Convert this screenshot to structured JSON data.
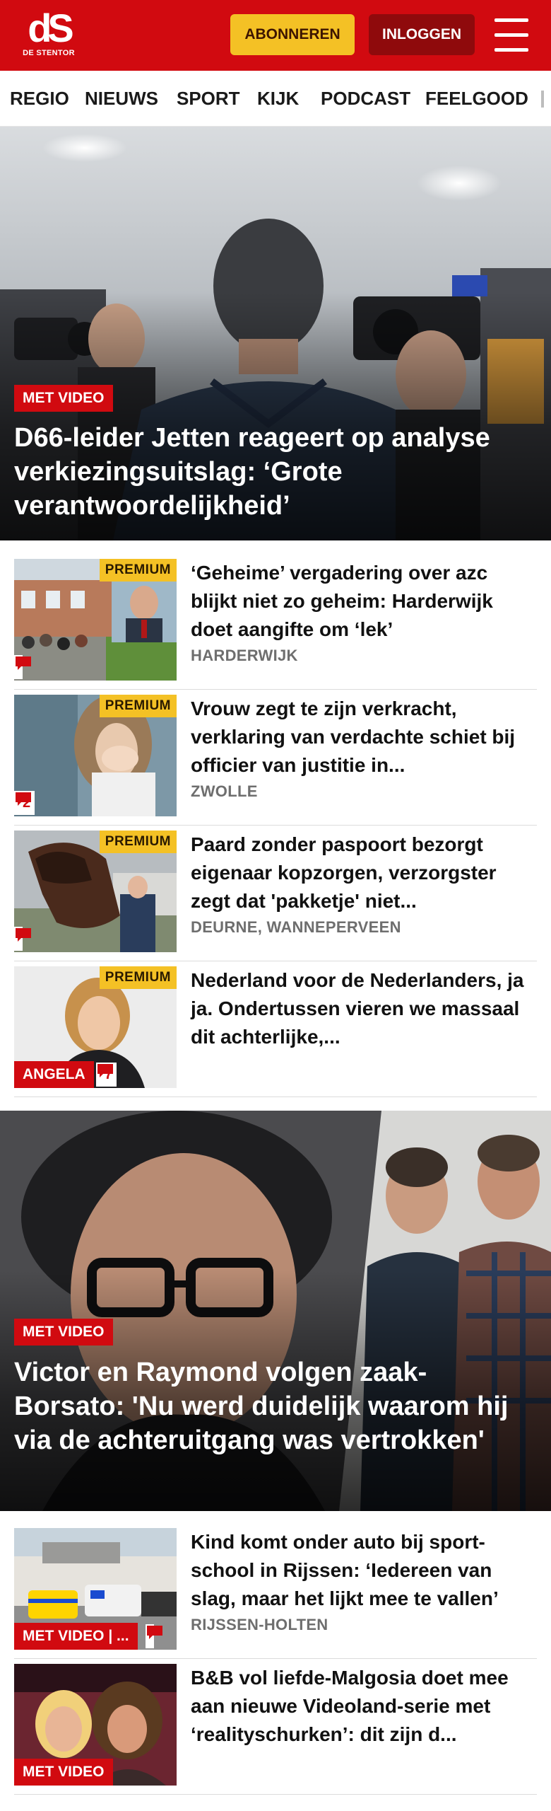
{
  "header": {
    "logo_mark": "dS",
    "logo_sub": "DE STENTOR",
    "subscribe_label": "ABONNEREN",
    "login_label": "INLOGGEN",
    "menu_icon": "hamburger-menu-icon",
    "brand_color": "#d10a10",
    "accent_color": "#f4c125"
  },
  "nav": {
    "items": [
      "REGIO",
      "NIEUWS",
      "SPORT",
      "KIJK",
      "PODCAST",
      "FEELGOOD"
    ]
  },
  "hero1": {
    "badge": "MET VIDEO",
    "title": "D66-leider Jetten reageert op analyse verkiezingsuitslag: ‘Grote verantwoordelijkheid’"
  },
  "articles1": [
    {
      "premium": "PREMIUM",
      "title": "‘Geheime’ vergadering over azc blijkt niet zo geheim: Harderwijk doet aangifte om ‘lek’",
      "meta": "HARDERWIJK",
      "comments": ""
    },
    {
      "premium": "PREMIUM",
      "title": "Vrouw zegt te zijn verkracht, verklaring van verdachte schiet bij officier van justitie in...",
      "meta": "ZWOLLE",
      "comments": "2"
    },
    {
      "premium": "PREMIUM",
      "title": "Paard zonder paspoort bezorgt eigenaar kopzorgen, verzorgster zegt dat 'pakketje' niet...",
      "meta": "DEURNE, WANNEPERVEEN",
      "comments": ""
    },
    {
      "premium": "PREMIUM",
      "title": "Nederland voor de Nederlanders, ja ja. Ondertussen vieren we massaal dit achterlijke,...",
      "meta": "",
      "label": "ANGELA",
      "comments": "7"
    }
  ],
  "hero2": {
    "badge": "MET VIDEO",
    "title": "Victor en Raymond volgen zaak-Borsato: 'Nu werd duidelijk waarom hij via de achteruitgang was vertrokken'"
  },
  "articles2": [
    {
      "title": "Kind komt onder auto bij sport-school in Rijssen: ‘Iedereen van slag, maar het lijkt mee te vallen’",
      "meta": "RIJSSEN-HOLTEN",
      "label": "MET VIDEO | ...",
      "comments": ""
    },
    {
      "title": "B&B vol liefde-Malgosia doet mee aan nieuwe Videoland-serie met ‘realityschurken’: dit zijn d...",
      "meta": "",
      "label": "MET VIDEO"
    }
  ]
}
